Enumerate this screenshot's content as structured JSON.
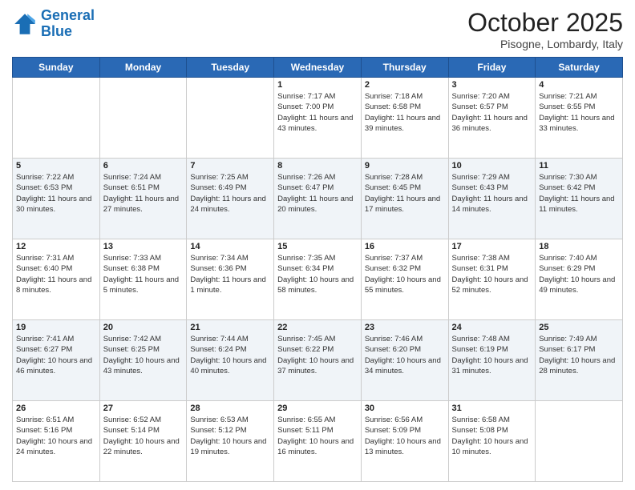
{
  "header": {
    "logo_line1": "General",
    "logo_line2": "Blue",
    "month": "October 2025",
    "location": "Pisogne, Lombardy, Italy"
  },
  "days_of_week": [
    "Sunday",
    "Monday",
    "Tuesday",
    "Wednesday",
    "Thursday",
    "Friday",
    "Saturday"
  ],
  "weeks": [
    [
      {
        "day": "",
        "info": ""
      },
      {
        "day": "",
        "info": ""
      },
      {
        "day": "",
        "info": ""
      },
      {
        "day": "1",
        "info": "Sunrise: 7:17 AM\nSunset: 7:00 PM\nDaylight: 11 hours\nand 43 minutes."
      },
      {
        "day": "2",
        "info": "Sunrise: 7:18 AM\nSunset: 6:58 PM\nDaylight: 11 hours\nand 39 minutes."
      },
      {
        "day": "3",
        "info": "Sunrise: 7:20 AM\nSunset: 6:57 PM\nDaylight: 11 hours\nand 36 minutes."
      },
      {
        "day": "4",
        "info": "Sunrise: 7:21 AM\nSunset: 6:55 PM\nDaylight: 11 hours\nand 33 minutes."
      }
    ],
    [
      {
        "day": "5",
        "info": "Sunrise: 7:22 AM\nSunset: 6:53 PM\nDaylight: 11 hours\nand 30 minutes."
      },
      {
        "day": "6",
        "info": "Sunrise: 7:24 AM\nSunset: 6:51 PM\nDaylight: 11 hours\nand 27 minutes."
      },
      {
        "day": "7",
        "info": "Sunrise: 7:25 AM\nSunset: 6:49 PM\nDaylight: 11 hours\nand 24 minutes."
      },
      {
        "day": "8",
        "info": "Sunrise: 7:26 AM\nSunset: 6:47 PM\nDaylight: 11 hours\nand 20 minutes."
      },
      {
        "day": "9",
        "info": "Sunrise: 7:28 AM\nSunset: 6:45 PM\nDaylight: 11 hours\nand 17 minutes."
      },
      {
        "day": "10",
        "info": "Sunrise: 7:29 AM\nSunset: 6:43 PM\nDaylight: 11 hours\nand 14 minutes."
      },
      {
        "day": "11",
        "info": "Sunrise: 7:30 AM\nSunset: 6:42 PM\nDaylight: 11 hours\nand 11 minutes."
      }
    ],
    [
      {
        "day": "12",
        "info": "Sunrise: 7:31 AM\nSunset: 6:40 PM\nDaylight: 11 hours\nand 8 minutes."
      },
      {
        "day": "13",
        "info": "Sunrise: 7:33 AM\nSunset: 6:38 PM\nDaylight: 11 hours\nand 5 minutes."
      },
      {
        "day": "14",
        "info": "Sunrise: 7:34 AM\nSunset: 6:36 PM\nDaylight: 11 hours\nand 1 minute."
      },
      {
        "day": "15",
        "info": "Sunrise: 7:35 AM\nSunset: 6:34 PM\nDaylight: 10 hours\nand 58 minutes."
      },
      {
        "day": "16",
        "info": "Sunrise: 7:37 AM\nSunset: 6:32 PM\nDaylight: 10 hours\nand 55 minutes."
      },
      {
        "day": "17",
        "info": "Sunrise: 7:38 AM\nSunset: 6:31 PM\nDaylight: 10 hours\nand 52 minutes."
      },
      {
        "day": "18",
        "info": "Sunrise: 7:40 AM\nSunset: 6:29 PM\nDaylight: 10 hours\nand 49 minutes."
      }
    ],
    [
      {
        "day": "19",
        "info": "Sunrise: 7:41 AM\nSunset: 6:27 PM\nDaylight: 10 hours\nand 46 minutes."
      },
      {
        "day": "20",
        "info": "Sunrise: 7:42 AM\nSunset: 6:25 PM\nDaylight: 10 hours\nand 43 minutes."
      },
      {
        "day": "21",
        "info": "Sunrise: 7:44 AM\nSunset: 6:24 PM\nDaylight: 10 hours\nand 40 minutes."
      },
      {
        "day": "22",
        "info": "Sunrise: 7:45 AM\nSunset: 6:22 PM\nDaylight: 10 hours\nand 37 minutes."
      },
      {
        "day": "23",
        "info": "Sunrise: 7:46 AM\nSunset: 6:20 PM\nDaylight: 10 hours\nand 34 minutes."
      },
      {
        "day": "24",
        "info": "Sunrise: 7:48 AM\nSunset: 6:19 PM\nDaylight: 10 hours\nand 31 minutes."
      },
      {
        "day": "25",
        "info": "Sunrise: 7:49 AM\nSunset: 6:17 PM\nDaylight: 10 hours\nand 28 minutes."
      }
    ],
    [
      {
        "day": "26",
        "info": "Sunrise: 6:51 AM\nSunset: 5:16 PM\nDaylight: 10 hours\nand 24 minutes."
      },
      {
        "day": "27",
        "info": "Sunrise: 6:52 AM\nSunset: 5:14 PM\nDaylight: 10 hours\nand 22 minutes."
      },
      {
        "day": "28",
        "info": "Sunrise: 6:53 AM\nSunset: 5:12 PM\nDaylight: 10 hours\nand 19 minutes."
      },
      {
        "day": "29",
        "info": "Sunrise: 6:55 AM\nSunset: 5:11 PM\nDaylight: 10 hours\nand 16 minutes."
      },
      {
        "day": "30",
        "info": "Sunrise: 6:56 AM\nSunset: 5:09 PM\nDaylight: 10 hours\nand 13 minutes."
      },
      {
        "day": "31",
        "info": "Sunrise: 6:58 AM\nSunset: 5:08 PM\nDaylight: 10 hours\nand 10 minutes."
      },
      {
        "day": "",
        "info": ""
      }
    ]
  ]
}
